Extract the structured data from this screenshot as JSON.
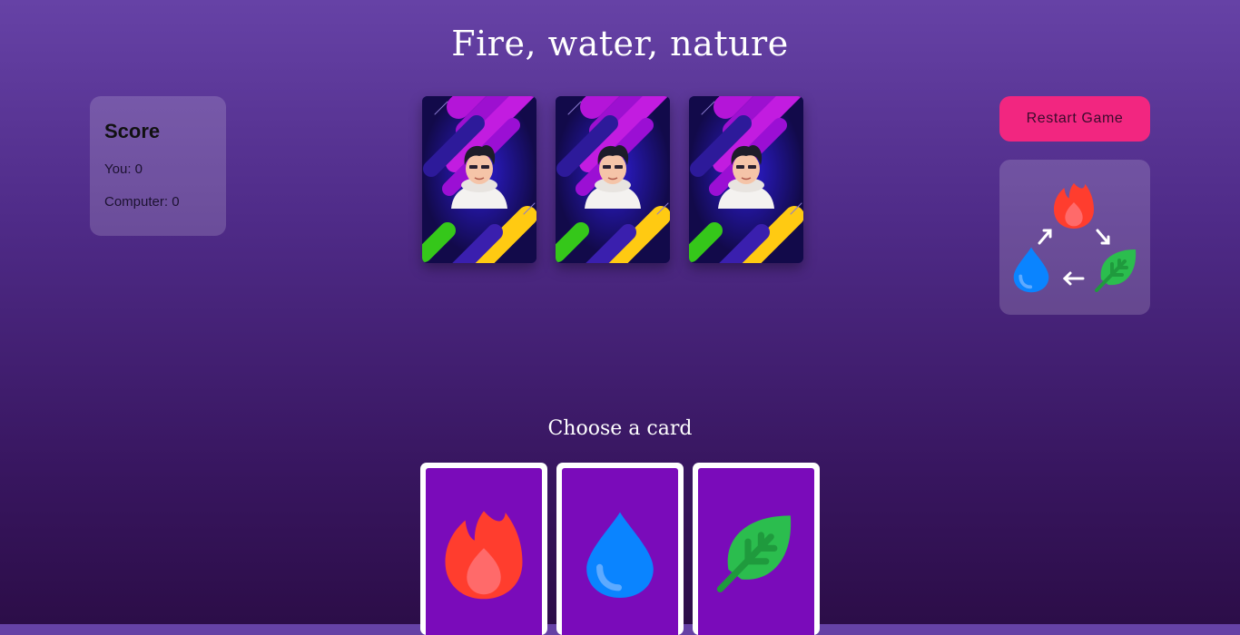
{
  "title": "Fire, water, nature",
  "score": {
    "heading": "Score",
    "you": "You: 0",
    "computer": "Computer: 0"
  },
  "computer_cards": [
    {
      "icon": "card-back-character-icon"
    },
    {
      "icon": "card-back-character-icon"
    },
    {
      "icon": "card-back-character-icon"
    }
  ],
  "restart_label": "Restart Game",
  "rules": {
    "icons": [
      "fire-icon",
      "water-drop-icon",
      "leaf-icon"
    ]
  },
  "choose_label": "Choose a card",
  "player_cards": [
    {
      "icon": "fire-icon"
    },
    {
      "icon": "water-drop-icon"
    },
    {
      "icon": "leaf-icon"
    }
  ],
  "colors": {
    "fire": "#ff3d2e",
    "water": "#0a84ff",
    "nature": "#2bbd4e",
    "restart": "#f22680",
    "card_face": "#7a0bba"
  }
}
